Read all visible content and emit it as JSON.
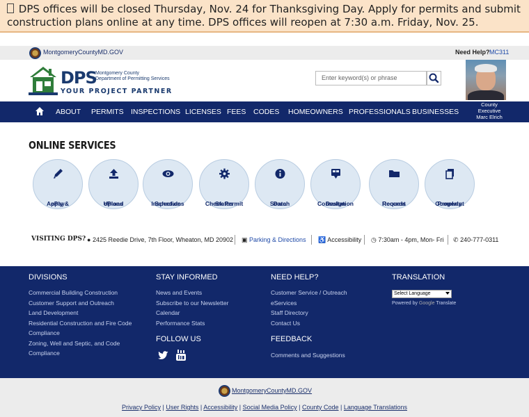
{
  "alert": {
    "text": "DPS offices will be closed Thursday, Nov. 24 for Thanksgiving Day. Apply for permits and submit construction plans online at any time. DPS offices will reopen at 7:30 a.m. Friday, Nov. 25."
  },
  "topbar": {
    "county_link": "MontgomeryCountyMD.GOV",
    "need_help": "Need Help?",
    "mc311": "MC311"
  },
  "logo": {
    "acronym": "DPS",
    "org_line1": "Montgomery County",
    "org_line2": "Department of Permitting Services",
    "tagline": "YOUR PROJECT PARTNER"
  },
  "search": {
    "placeholder": "Enter keyword(s) or phrase"
  },
  "executive": {
    "line1": "County",
    "line2": "Executive",
    "line3": "Marc Elrich"
  },
  "nav": {
    "items": [
      "ABOUT",
      "PERMITS",
      "INSPECTIONS",
      "LICENSES",
      "FEES",
      "CODES",
      "HOMEOWNERS",
      "PROFESSIONALS",
      "BUSINESSES"
    ]
  },
  "online_services": {
    "title": "ONLINE SERVICES",
    "items": [
      {
        "line1": "Apply &",
        "line2": "ePay",
        "icon": "pencil-icon"
      },
      {
        "line1": "ePlans",
        "line2": "Upload",
        "icon": "upload-icon"
      },
      {
        "line1": "Schedule",
        "line2": "Inspections",
        "icon": "eye-icon"
      },
      {
        "line1": "Check Permit",
        "line2": "Status",
        "icon": "gear-icon"
      },
      {
        "line1": "Data",
        "line2": "Search",
        "icon": "info-icon"
      },
      {
        "line1": "Design",
        "line2": "Consultation",
        "icon": "consultation-icon"
      },
      {
        "line1": "Request",
        "line2": "Records",
        "icon": "folder-icon"
      },
      {
        "line1": "Property",
        "line2": "Complaint",
        "icon": "document-icon"
      }
    ]
  },
  "visiting": {
    "title": "VISITING DPS?",
    "address": "2425 Reedie Drive, 7th Floor, Wheaton, MD 20902",
    "parking": "Parking & Directions",
    "accessibility": "Accessibility",
    "hours": "7:30am - 4pm, Mon- Fri",
    "phone": "240-777-0311"
  },
  "footer": {
    "divisions": {
      "title": "DIVISIONS",
      "links": [
        "Commercial Building Construction",
        "Customer Support and Outreach",
        "Land Development",
        "Residential Construction and Fire Code",
        "Compliance",
        "Zoning, Well and Septic, and Code",
        "Compliance"
      ]
    },
    "stay_informed": {
      "title": "STAY INFORMED",
      "links": [
        "News and Events",
        "Subscribe to our Newsletter",
        "Calendar",
        "Performance Stats"
      ]
    },
    "follow_us": {
      "title": "FOLLOW US"
    },
    "need_help": {
      "title": "NEED HELP?",
      "links": [
        "Customer Service / Outreach",
        "eServices",
        "Staff Directory",
        "Contact Us"
      ]
    },
    "feedback": {
      "title": "FEEDBACK",
      "links": [
        "Comments and Suggestions"
      ]
    },
    "translation": {
      "title": "TRANSLATION",
      "select_value": "Select Language",
      "powered_by": "Powered by",
      "google": "Google",
      "translate": "Translate"
    }
  },
  "bottom": {
    "county_link": "MontgomeryCountyMD.GOV",
    "links": [
      "Privacy Policy",
      "User Rights",
      "Accessibility",
      "Social Media Policy",
      "County Code",
      "Language Translations"
    ]
  },
  "colors": {
    "navy": "#12286a",
    "alert_bg": "#fbe3c8",
    "circle_bg": "#dde8f3",
    "link": "#1f4aa8"
  }
}
